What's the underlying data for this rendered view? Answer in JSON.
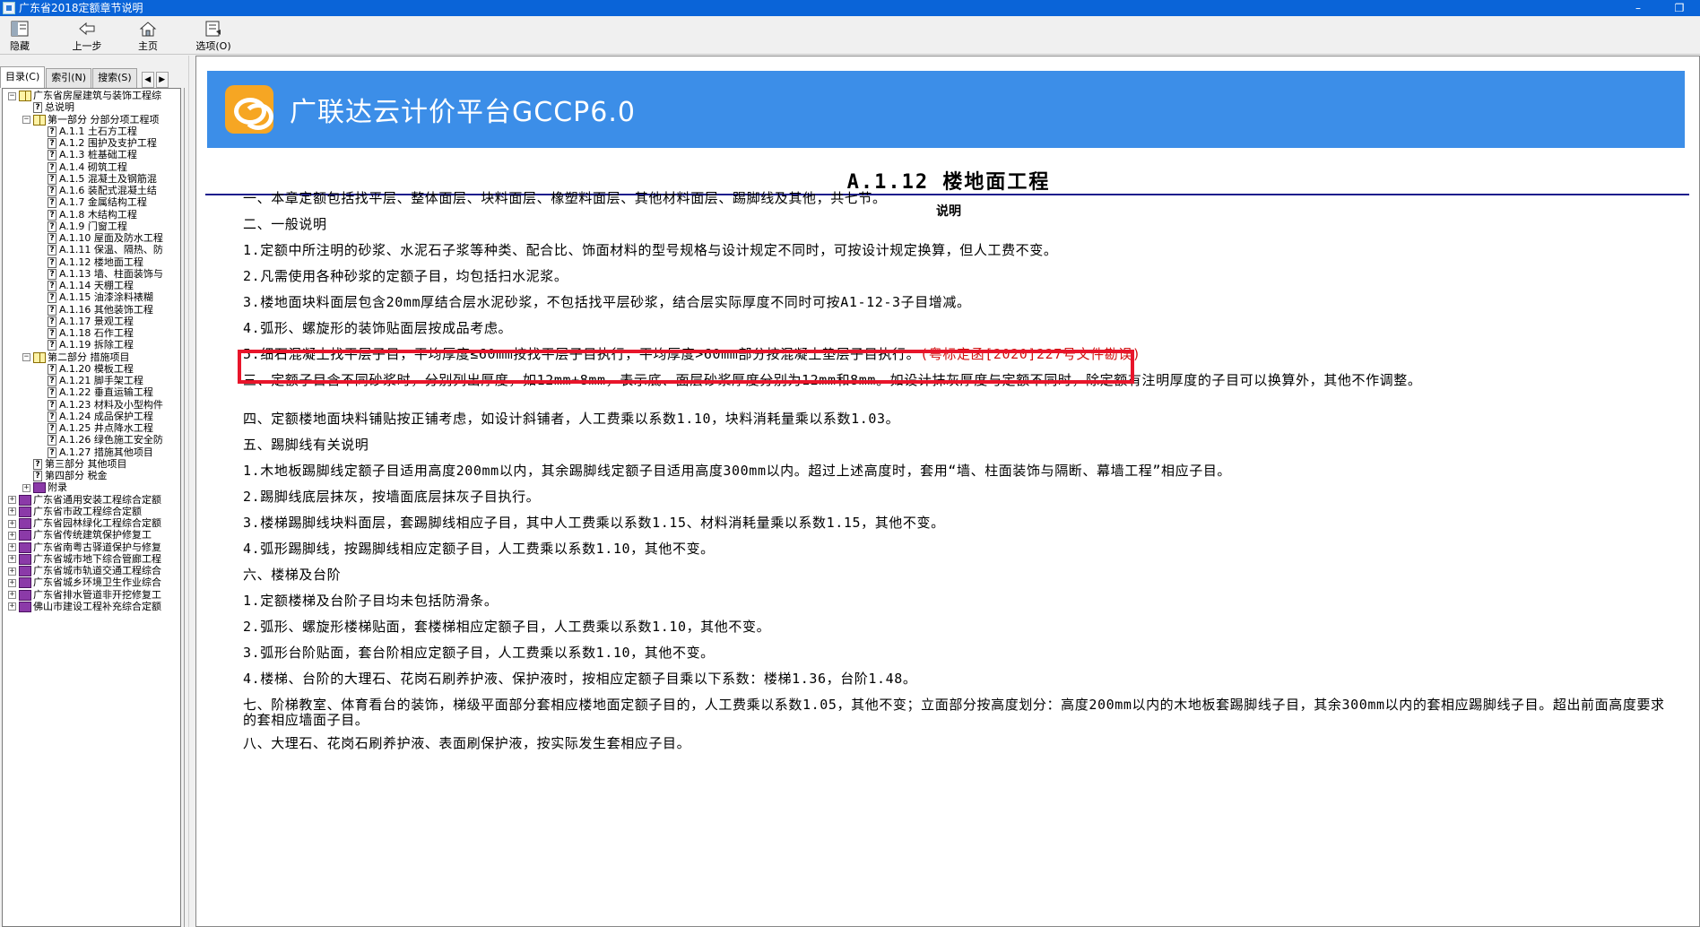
{
  "window": {
    "title": "广东省2018定额章节说明",
    "controls": [
      "–",
      "❐"
    ]
  },
  "toolbar": {
    "items": [
      {
        "label": "隐藏",
        "icon": "hide-icon"
      },
      {
        "label": "上一步",
        "icon": "back-arrow-icon"
      },
      {
        "label": "主页",
        "icon": "home-icon"
      },
      {
        "label": "选项(O)",
        "icon": "options-icon"
      }
    ]
  },
  "tabs": [
    {
      "label": "目录(C)",
      "active": true
    },
    {
      "label": "索引(N)",
      "active": false
    },
    {
      "label": "搜索(S)",
      "active": false
    }
  ],
  "tab_arrows": [
    "◀",
    "▶"
  ],
  "tree": [
    {
      "level": 0,
      "exp": "−",
      "icon": "open",
      "text": "广东省房屋建筑与装饰工程综"
    },
    {
      "level": 1,
      "exp": "",
      "icon": "help",
      "text": "总说明"
    },
    {
      "level": 1,
      "exp": "−",
      "icon": "open",
      "text": "第一部分 分部分项工程项"
    },
    {
      "level": 2,
      "exp": "",
      "icon": "help",
      "text": "A.1.1 土石方工程"
    },
    {
      "level": 2,
      "exp": "",
      "icon": "help",
      "text": "A.1.2 围护及支护工程"
    },
    {
      "level": 2,
      "exp": "",
      "icon": "help",
      "text": "A.1.3 桩基础工程"
    },
    {
      "level": 2,
      "exp": "",
      "icon": "help",
      "text": "A.1.4 砌筑工程"
    },
    {
      "level": 2,
      "exp": "",
      "icon": "help",
      "text": "A.1.5 混凝土及钢筋混"
    },
    {
      "level": 2,
      "exp": "",
      "icon": "help",
      "text": "A.1.6 装配式混凝土结"
    },
    {
      "level": 2,
      "exp": "",
      "icon": "help",
      "text": "A.1.7 金属结构工程"
    },
    {
      "level": 2,
      "exp": "",
      "icon": "help",
      "text": "A.1.8 木结构工程"
    },
    {
      "level": 2,
      "exp": "",
      "icon": "help",
      "text": "A.1.9 门窗工程"
    },
    {
      "level": 2,
      "exp": "",
      "icon": "help",
      "text": "A.1.10 屋面及防水工程"
    },
    {
      "level": 2,
      "exp": "",
      "icon": "help",
      "text": "A.1.11 保温、隔热、防"
    },
    {
      "level": 2,
      "exp": "",
      "icon": "help",
      "text": "A.1.12 楼地面工程",
      "selected": true
    },
    {
      "level": 2,
      "exp": "",
      "icon": "help",
      "text": "A.1.13 墙、柱面装饰与"
    },
    {
      "level": 2,
      "exp": "",
      "icon": "help",
      "text": "A.1.14 天棚工程"
    },
    {
      "level": 2,
      "exp": "",
      "icon": "help",
      "text": "A.1.15 油漆涂料裱糊"
    },
    {
      "level": 2,
      "exp": "",
      "icon": "help",
      "text": "A.1.16 其他装饰工程"
    },
    {
      "level": 2,
      "exp": "",
      "icon": "help",
      "text": "A.1.17 景观工程"
    },
    {
      "level": 2,
      "exp": "",
      "icon": "help",
      "text": "A.1.18 石作工程"
    },
    {
      "level": 2,
      "exp": "",
      "icon": "help",
      "text": "A.1.19 拆除工程"
    },
    {
      "level": 1,
      "exp": "−",
      "icon": "open",
      "text": "第二部分 措施项目"
    },
    {
      "level": 2,
      "exp": "",
      "icon": "help",
      "text": "A.1.20 模板工程"
    },
    {
      "level": 2,
      "exp": "",
      "icon": "help",
      "text": "A.1.21 脚手架工程"
    },
    {
      "level": 2,
      "exp": "",
      "icon": "help",
      "text": "A.1.22 垂直运输工程"
    },
    {
      "level": 2,
      "exp": "",
      "icon": "help",
      "text": "A.1.23 材料及小型构件"
    },
    {
      "level": 2,
      "exp": "",
      "icon": "help",
      "text": "A.1.24 成品保护工程"
    },
    {
      "level": 2,
      "exp": "",
      "icon": "help",
      "text": "A.1.25 井点降水工程"
    },
    {
      "level": 2,
      "exp": "",
      "icon": "help",
      "text": "A.1.26 绿色施工安全防"
    },
    {
      "level": 2,
      "exp": "",
      "icon": "help",
      "text": "A.1.27 措施其他项目"
    },
    {
      "level": 1,
      "exp": "",
      "icon": "help",
      "text": "第三部分 其他项目"
    },
    {
      "level": 1,
      "exp": "",
      "icon": "help",
      "text": "第四部分 税金"
    },
    {
      "level": 1,
      "exp": "+",
      "icon": "closed",
      "text": "附录"
    },
    {
      "level": 0,
      "exp": "+",
      "icon": "closed",
      "text": "广东省通用安装工程综合定额"
    },
    {
      "level": 0,
      "exp": "+",
      "icon": "closed",
      "text": "广东省市政工程综合定额"
    },
    {
      "level": 0,
      "exp": "+",
      "icon": "closed",
      "text": "广东省园林绿化工程综合定额"
    },
    {
      "level": 0,
      "exp": "+",
      "icon": "closed",
      "text": "广东省传统建筑保护修复工"
    },
    {
      "level": 0,
      "exp": "+",
      "icon": "closed",
      "text": "广东省南粤古驿道保护与修复"
    },
    {
      "level": 0,
      "exp": "+",
      "icon": "closed",
      "text": "广东省城市地下综合管廊工程"
    },
    {
      "level": 0,
      "exp": "+",
      "icon": "closed",
      "text": "广东省城市轨道交通工程综合"
    },
    {
      "level": 0,
      "exp": "+",
      "icon": "closed",
      "text": "广东省城乡环境卫生作业综合"
    },
    {
      "level": 0,
      "exp": "+",
      "icon": "closed",
      "text": "广东省排水管道非开挖修复工"
    },
    {
      "level": 0,
      "exp": "+",
      "icon": "closed",
      "text": "佛山市建设工程补充综合定额"
    }
  ],
  "banner": {
    "title": "广联达云计价平台GCCP6.0",
    "color": "#3c8ee8",
    "logo_color": "#f6a623"
  },
  "doc": {
    "heading": "A.1.12 楼地面工程",
    "subheading": "说明",
    "paragraphs": [
      {
        "text": "一、本章定额包括找平层、整体面层、块料面层、橡塑料面层、其他材料面层、踢脚线及其他，共七节。"
      },
      {
        "text": "二、一般说明"
      },
      {
        "text": "1.定额中所注明的砂浆、水泥石子浆等种类、配合比、饰面材料的型号规格与设计规定不同时，可按设计规定换算，但人工费不变。"
      },
      {
        "text": "2.凡需使用各种砂浆的定额子目，均包括扫水泥浆。"
      },
      {
        "text": "3.楼地面块料面层包含20mm厚结合层水泥砂浆，不包括找平层砂浆，结合层实际厚度不同时可按A1-12-3子目增减。",
        "boxed": true
      },
      {
        "text": "4.弧形、螺旋形的装饰贴面层按成品考虑。"
      },
      {
        "text": "5.细石混凝土找平层子目，平均厚度≤60mm按找平层子目执行，平均厚度>60mm部分按混凝土垫层子目执行。",
        "note": "(粤标定函[2020]227号文件勘误)"
      },
      {
        "text": "三、定额子目含不同砂浆时，分别列出厚度，如12mm+8mm，表示底、面层砂浆厚度分别为12mm和8mm。如设计抹灰厚度与定额不同时，除定额有注明厚度的子目可以换算外，其他不作调整。"
      },
      {
        "text": "四、定额楼地面块料铺贴按正铺考虑，如设计斜铺者，人工费乘以系数1.10，块料消耗量乘以系数1.03。"
      },
      {
        "text": "五、踢脚线有关说明"
      },
      {
        "text": "1.木地板踢脚线定额子目适用高度200mm以内，其余踢脚线定额子目适用高度300mm以内。超过上述高度时，套用“墙、柱面装饰与隔断、幕墙工程”相应子目。"
      },
      {
        "text": "2.踢脚线底层抹灰，按墙面底层抹灰子目执行。"
      },
      {
        "text": "3.楼梯踢脚线块料面层，套踢脚线相应子目，其中人工费乘以系数1.15、材料消耗量乘以系数1.15，其他不变。"
      },
      {
        "text": "4.弧形踢脚线，按踢脚线相应定额子目，人工费乘以系数1.10，其他不变。"
      },
      {
        "text": "六、楼梯及台阶"
      },
      {
        "text": "1.定额楼梯及台阶子目均未包括防滑条。"
      },
      {
        "text": "2.弧形、螺旋形楼梯贴面，套楼梯相应定额子目，人工费乘以系数1.10，其他不变。"
      },
      {
        "text": "3.弧形台阶贴面，套台阶相应定额子目，人工费乘以系数1.10，其他不变。"
      },
      {
        "text": "4.楼梯、台阶的大理石、花岗石刷养护液、保护液时，按相应定额子目乘以下系数：楼梯1.36，台阶1.48。"
      },
      {
        "text": "七、阶梯教室、体育看台的装饰，梯级平面部分套相应楼地面定额子目的，人工费乘以系数1.05，其他不变；立面部分按高度划分：高度200mm以内的木地板套踢脚线子目，其余300mm以内的套相应踢脚线子目。超出前面高度要求的套相应墙面子目。"
      },
      {
        "text": "八、大理石、花岗石刷养护液、表面刷保护液，按实际发生套相应子目。"
      }
    ]
  }
}
